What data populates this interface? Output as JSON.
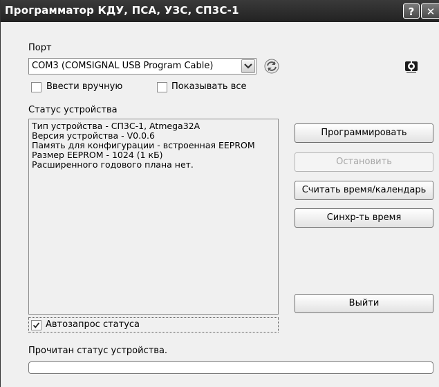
{
  "window": {
    "title": "Программатор КДУ, ПСА, УЗС, СП3С-1",
    "help_label": "?",
    "close_label": "✕"
  },
  "port": {
    "label": "Порт",
    "selected": "COM3 (COMSIGNAL USB Program Cable)",
    "manual_label": "Ввести вручную",
    "manual_checked": false,
    "show_all_label": "Показывать все",
    "show_all_checked": false
  },
  "status": {
    "label": "Статус устройства",
    "lines": [
      "Тип устройства - СП3С-1, Atmega32A",
      "Версия устройства - V0.0.6",
      "Память для конфигурации - встроенная EEPROM",
      "Размер EEPROM - 1024 (1 кБ)",
      "Расширенного годового плана нет."
    ],
    "auto_request_label": "Автозапрос статуса",
    "auto_request_checked": true
  },
  "buttons": {
    "program": "Программировать",
    "stop": "Остановить",
    "read_time": "Считать время/календарь",
    "sync_time": "Синхр-ть время",
    "exit": "Выйти"
  },
  "footer": {
    "message": "Прочитан статус устройства.",
    "progress": 0
  },
  "icons": {
    "refresh": "refresh-icon",
    "settings": "settings-icon",
    "dropdown": "chevron-down-icon",
    "check": "check-icon"
  }
}
